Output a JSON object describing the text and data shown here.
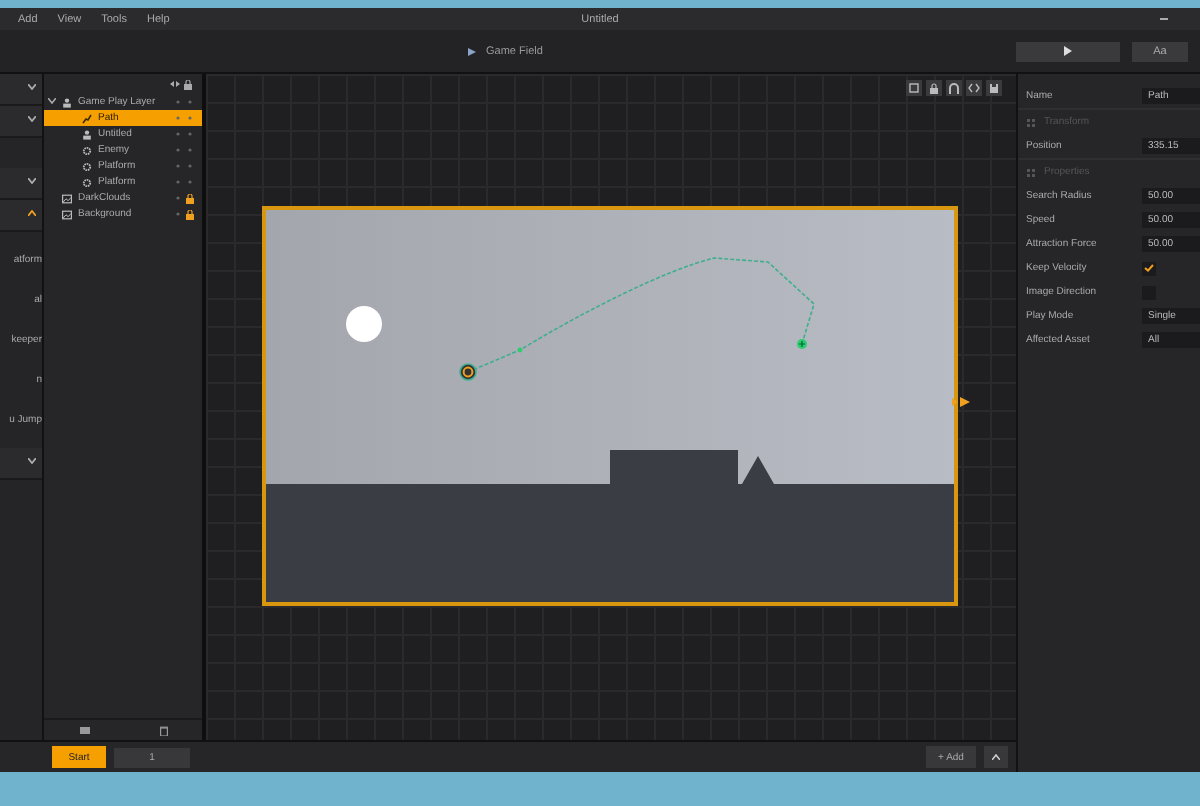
{
  "window": {
    "title": "Untitled",
    "menu": [
      "Add",
      "View",
      "Tools",
      "Help"
    ]
  },
  "toolbar": {
    "breadcrumb": "Game Field",
    "font_button": "Aa"
  },
  "sidebar": {
    "sections": [
      {
        "expanded": false
      },
      {
        "expanded": false
      },
      {
        "expanded": false
      },
      {
        "expanded": true,
        "items": [
          "atform",
          "al",
          "keeper",
          "n",
          "u Jump"
        ]
      },
      {
        "expanded": false
      }
    ]
  },
  "layers": [
    {
      "name": "Game Play Layer",
      "kind": "layer",
      "selected": false,
      "locked": false,
      "children": [
        {
          "name": "Path",
          "kind": "path",
          "selected": true,
          "locked": false
        },
        {
          "name": "Untitled",
          "kind": "sprite",
          "selected": false,
          "locked": false
        },
        {
          "name": "Enemy",
          "kind": "gear",
          "selected": false,
          "locked": false
        },
        {
          "name": "Platform",
          "kind": "gear",
          "selected": false,
          "locked": false
        },
        {
          "name": "Platform",
          "kind": "gear",
          "selected": false,
          "locked": false
        }
      ]
    },
    {
      "name": "DarkClouds",
      "kind": "image",
      "selected": false,
      "locked": true
    },
    {
      "name": "Background",
      "kind": "image",
      "selected": false,
      "locked": true
    }
  ],
  "inspector": [
    {
      "kind": "field",
      "label": "Name",
      "value": "Path"
    },
    {
      "kind": "header",
      "label": "Transform"
    },
    {
      "kind": "field",
      "label": "Position",
      "value": "335.15"
    },
    {
      "kind": "header",
      "label": "Properties"
    },
    {
      "kind": "field",
      "label": "Search Radius",
      "value": "50.00"
    },
    {
      "kind": "field",
      "label": "Speed",
      "value": "50.00"
    },
    {
      "kind": "field",
      "label": "Attraction Force",
      "value": "50.00"
    },
    {
      "kind": "check",
      "label": "Keep Velocity",
      "checked": true
    },
    {
      "kind": "check",
      "label": "Image Direction",
      "checked": false
    },
    {
      "kind": "field",
      "label": "Play Mode",
      "value": "Single"
    },
    {
      "kind": "field",
      "label": "Affected Asset",
      "value": "All"
    }
  ],
  "bottom_bar": {
    "start_button": "Start",
    "frame_value": "1",
    "add_button": "+ Add"
  }
}
